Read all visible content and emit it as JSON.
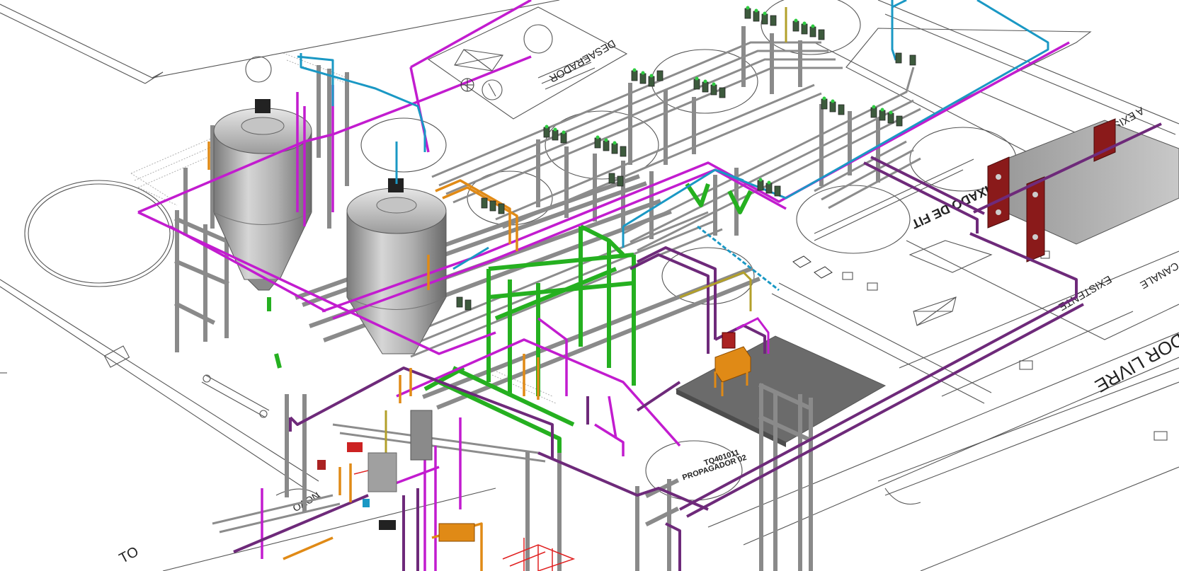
{
  "floor_labels": {
    "desaerador": "DESAERADOR",
    "tag_number": "TQ401011",
    "propagador": "PROPAGADOR 02",
    "edge_right": "DOR LIVRE",
    "existente_1": "EXISTENTE",
    "existente_2": "CANALE",
    "existente_3": "A EXISTENTE",
    "channel_label": "FIXADO DE FIT",
    "bottom_left": "TO",
    "novo": "NOVO"
  },
  "colors": {
    "background": "#ffffff",
    "floor_lines": "#555555",
    "steel": "#9a9a9a",
    "steel_dark": "#6d6d6d",
    "pipe_magenta": "#c21ccf",
    "pipe_purple": "#6e2a7a",
    "pipe_cyan": "#1a98c4",
    "pipe_green": "#25b020",
    "pipe_orange": "#e08a16",
    "pipe_red": "#e02020",
    "tank": "#b8b8b8",
    "heat_exchanger": "#8a1a1a",
    "platform": "#6b6b6b"
  },
  "icons": [
    "tank-icon",
    "valve-icon",
    "heat-exchanger-icon",
    "pump-icon"
  ]
}
